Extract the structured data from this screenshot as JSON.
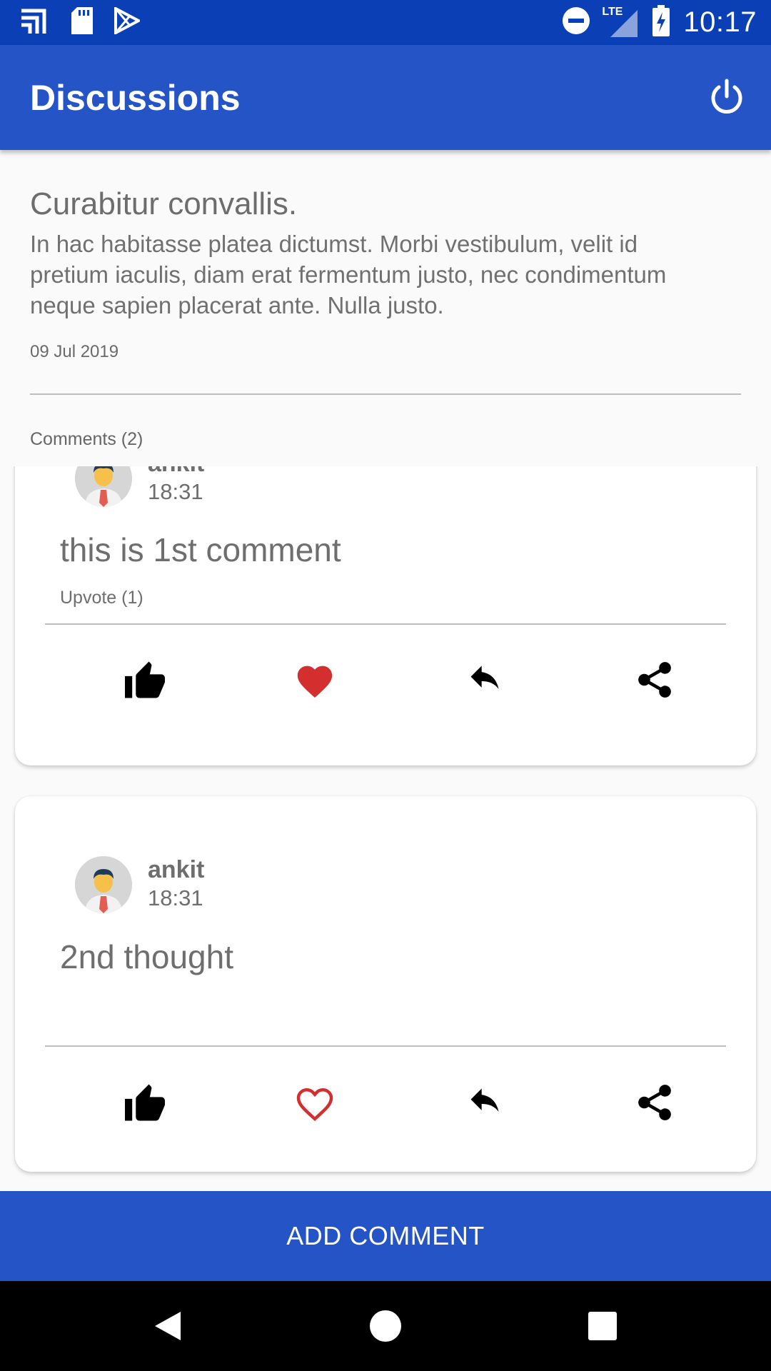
{
  "status_bar": {
    "time": "10:17",
    "network_label": "LTE",
    "icons": [
      "notification-stack-icon",
      "sd-card-icon",
      "play-store-icon",
      "do-not-disturb-icon",
      "lte-signal-icon",
      "battery-charging-icon"
    ]
  },
  "app_bar": {
    "title": "Discussions",
    "power_icon": "power-icon"
  },
  "post": {
    "title": "Curabitur convallis.",
    "body": "In hac habitasse platea dictumst. Morbi vestibulum, velit id pretium iaculis, diam erat fermentum justo, nec condimentum neque sapien placerat ante. Nulla justo.",
    "date": "09 Jul 2019",
    "comments_label": "Comments (2)"
  },
  "comments": [
    {
      "author": "ankit",
      "time": "18:31",
      "text": "this is 1st comment",
      "upvote_label": "Upvote (1)",
      "liked": true
    },
    {
      "author": "ankit",
      "time": "18:31",
      "text": "2nd thought",
      "upvote_label": "",
      "liked": false
    }
  ],
  "colors": {
    "status_bar": "#0a3fb6",
    "primary": "#2554c7",
    "heart": "#d32f2f"
  },
  "add_comment": {
    "label": "ADD COMMENT"
  },
  "nav": {
    "icons": [
      "back-icon",
      "home-icon",
      "recents-icon"
    ]
  }
}
